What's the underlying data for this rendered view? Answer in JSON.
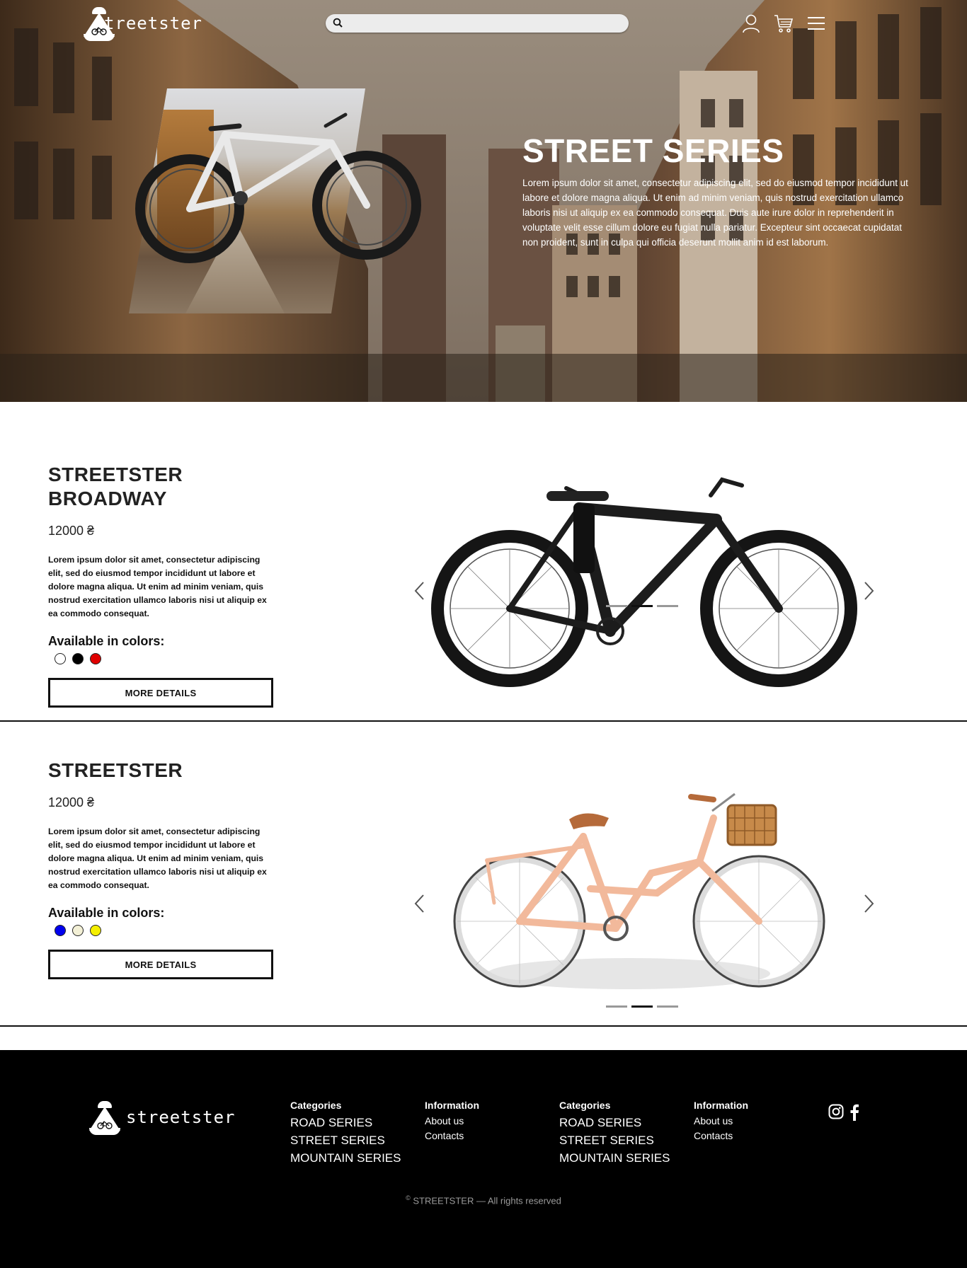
{
  "header": {
    "brand": "streetster",
    "search_placeholder": "",
    "icons": [
      "user-icon",
      "cart-icon",
      "menu-icon"
    ]
  },
  "hero": {
    "title": "STREET SERIES",
    "text": "Lorem ipsum dolor sit amet, consectetur adipiscing elit, sed do eiusmod tempor incididunt ut labore et dolore magna aliqua. Ut enim ad minim veniam, quis nostrud exercitation ullamco laboris nisi ut aliquip ex ea commodo consequat. Duis aute irure dolor in reprehenderit in voluptate velit esse cillum dolore eu fugiat nulla pariatur. Excepteur sint occaecat cupidatat non proident, sunt in culpa qui officia deserunt mollit anim id est laborum."
  },
  "products": [
    {
      "title_line1": "STREETSTER",
      "title_line2": "BROADWAY",
      "price": "12000 ₴",
      "description": "Lorem ipsum dolor sit amet, consectetur adipiscing elit, sed do eiusmod tempor incididunt ut labore et dolore magna aliqua. Ut enim ad minim veniam, quis nostrud exercitation ullamco laboris nisi ut aliquip ex ea commodo consequat.",
      "colors_label": "Available in colors:",
      "colors": [
        "#ffffff",
        "#000000",
        "#e00000"
      ],
      "button": "MORE DETAILS",
      "active_slide": 2,
      "slides": 3
    },
    {
      "title_line1": "STREETSTER",
      "title_line2": "",
      "price": "12000 ₴",
      "description": "Lorem ipsum dolor sit amet, consectetur adipiscing elit, sed do eiusmod tempor incididunt ut labore et dolore magna aliqua. Ut enim ad minim veniam, quis nostrud exercitation ullamco laboris nisi ut aliquip ex ea commodo consequat.",
      "colors_label": "Available in colors:",
      "colors": [
        "#0000ee",
        "#f3f0d6",
        "#f5ef00"
      ],
      "button": "MORE DETAILS",
      "active_slide": 2,
      "slides": 3
    }
  ],
  "footer": {
    "brand": "streetster",
    "columns": [
      {
        "heading": "Categories",
        "items": [
          "ROAD SERIES",
          "STREET SERIES",
          "MOUNTAIN SERIES"
        ]
      },
      {
        "heading": "Information",
        "items": [
          "About us",
          "Contacts"
        ]
      },
      {
        "heading": "Categories",
        "items": [
          "ROAD SERIES",
          "STREET SERIES",
          "MOUNTAIN SERIES"
        ]
      },
      {
        "heading": "Information",
        "items": [
          "About us",
          "Contacts"
        ]
      }
    ],
    "social": [
      "instagram-icon",
      "facebook-icon"
    ],
    "copyright_mark": "©",
    "copyright": "STREETSTER — All rights reserved"
  },
  "colors": {
    "footer_bg": "#000000",
    "text_dark": "#222222",
    "copyright_grey": "#9a9a9a"
  }
}
